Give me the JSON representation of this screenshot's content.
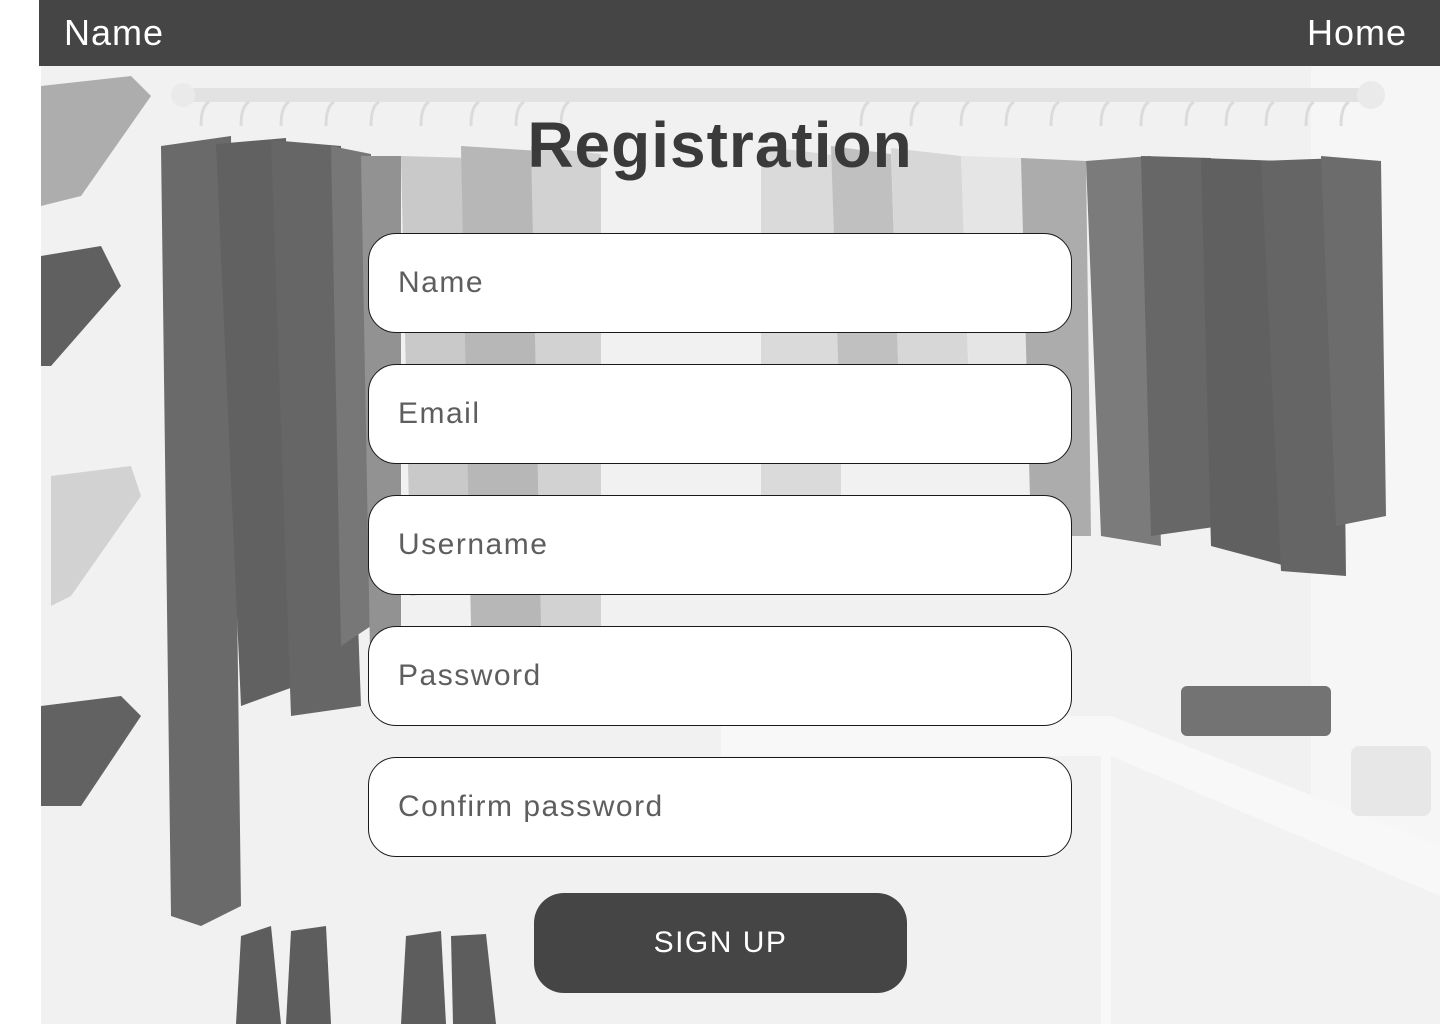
{
  "nav": {
    "brand": "Name",
    "home": "Home"
  },
  "form": {
    "title": "Registration",
    "fields": {
      "name": "Name",
      "email": "Email",
      "username": "Username",
      "password": "Password",
      "confirm_password": "Confirm password"
    },
    "submit_label": "SIGN UP"
  },
  "colors": {
    "navbar": "#454545",
    "button": "#454545",
    "field_bg": "#ffffff",
    "title": "#3a3a3a"
  }
}
